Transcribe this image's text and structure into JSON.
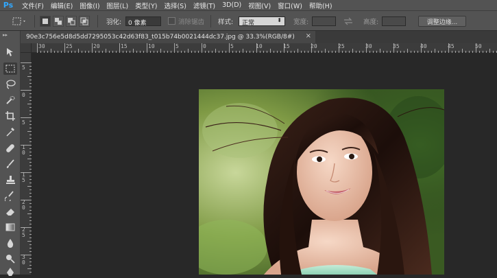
{
  "app": {
    "logo": "Ps"
  },
  "menu": [
    "文件(F)",
    "编辑(E)",
    "图像(I)",
    "图层(L)",
    "类型(Y)",
    "选择(S)",
    "滤镜(T)",
    "3D(D)",
    "视图(V)",
    "窗口(W)",
    "帮助(H)"
  ],
  "options": {
    "feather_label": "羽化:",
    "feather_value": "0 像素",
    "antialias_label": "消除锯齿",
    "style_label": "样式:",
    "style_value": "正常",
    "width_label": "宽度:",
    "height_label": "高度:",
    "refine_edge_label": "调整边缘..."
  },
  "document": {
    "tab_title": "90e3c756e5d8d5dd7295053c42d63f83_t015b74b0021444dc37.jpg @ 33.3%(RGB/8#)",
    "close_glyph": "×"
  },
  "ruler": {
    "top_labels": [
      "30",
      "25",
      "20",
      "15",
      "10",
      "5",
      "0",
      "5",
      "10",
      "15",
      "20",
      "25",
      "30",
      "35",
      "40",
      "45",
      "50"
    ],
    "left_labels": [
      "5",
      "0",
      "5",
      "1 0",
      "1 5",
      "2 0",
      "2 5",
      "3 0"
    ]
  },
  "colors": {
    "menubar": "#535353",
    "canvas": "#282828",
    "accent": "#31a8ff"
  }
}
